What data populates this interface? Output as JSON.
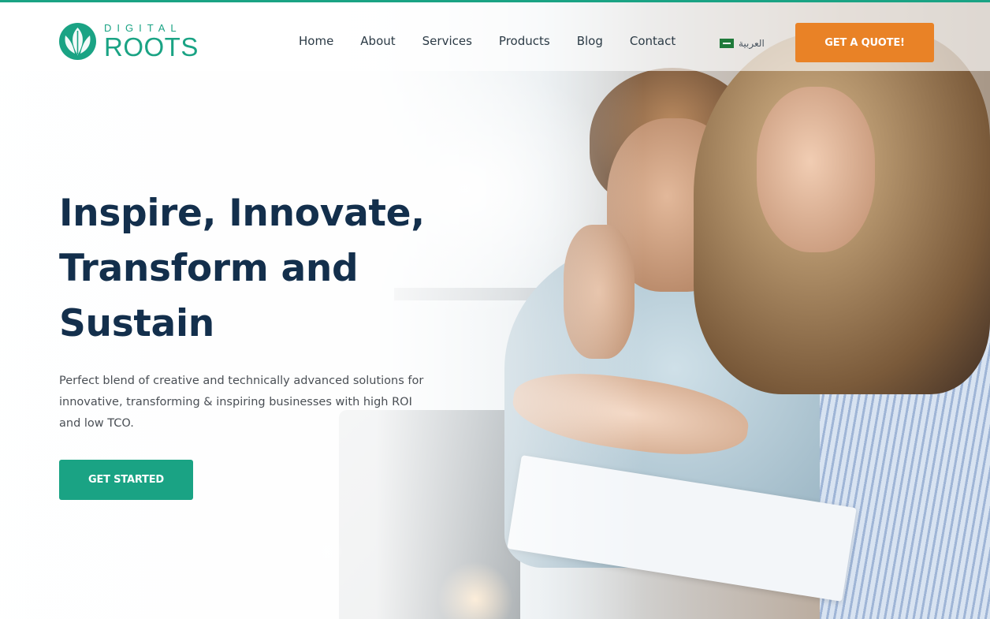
{
  "brand": {
    "logo_small": "DIGITAL",
    "logo_big": "ROOTS",
    "accent_color": "#1aa384",
    "quote_color": "#e98226"
  },
  "nav": {
    "items": [
      {
        "label": "Home"
      },
      {
        "label": "About"
      },
      {
        "label": "Services"
      },
      {
        "label": "Products"
      },
      {
        "label": "Blog"
      },
      {
        "label": "Contact"
      }
    ],
    "language_label": "العربية",
    "language_icon": "saudi-flag-icon"
  },
  "header": {
    "quote_button_label": "GET A QUOTE!"
  },
  "hero": {
    "headline_lines": [
      "Inspire, Innovate,",
      "Transform and",
      "Sustain"
    ],
    "subtext": "Perfect blend of creative and technically advanced solutions for innovative, transforming & inspiring businesses with high ROI and low TCO.",
    "cta_label": "GET STARTED"
  }
}
